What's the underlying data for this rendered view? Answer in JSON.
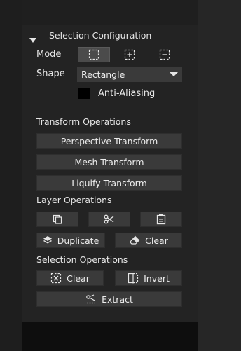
{
  "section": {
    "title": "Selection Configuration"
  },
  "mode": {
    "label": "Mode",
    "options": [
      {
        "icon": "marquee-replace-icon",
        "selected": true
      },
      {
        "icon": "marquee-add-icon",
        "selected": false
      },
      {
        "icon": "marquee-subtract-icon",
        "selected": false
      }
    ]
  },
  "shape": {
    "label": "Shape",
    "value": "Rectangle"
  },
  "anti_aliasing": {
    "label": "Anti-Aliasing",
    "checked": false
  },
  "transform": {
    "title": "Transform Operations",
    "perspective": "Perspective Transform",
    "mesh": "Mesh Transform",
    "liquify": "Liquify Transform"
  },
  "layer": {
    "title": "Layer Operations",
    "copy_icon": "copy-icon",
    "cut_icon": "scissors-icon",
    "paste_icon": "clipboard-icon",
    "duplicate": "Duplicate",
    "clear": "Clear"
  },
  "selection_ops": {
    "title": "Selection Operations",
    "clear": "Clear",
    "invert": "Invert",
    "extract": "Extract"
  },
  "colors": {
    "panel": "#232323",
    "button": "#3a3a3a",
    "text": "#e6e6e6"
  }
}
